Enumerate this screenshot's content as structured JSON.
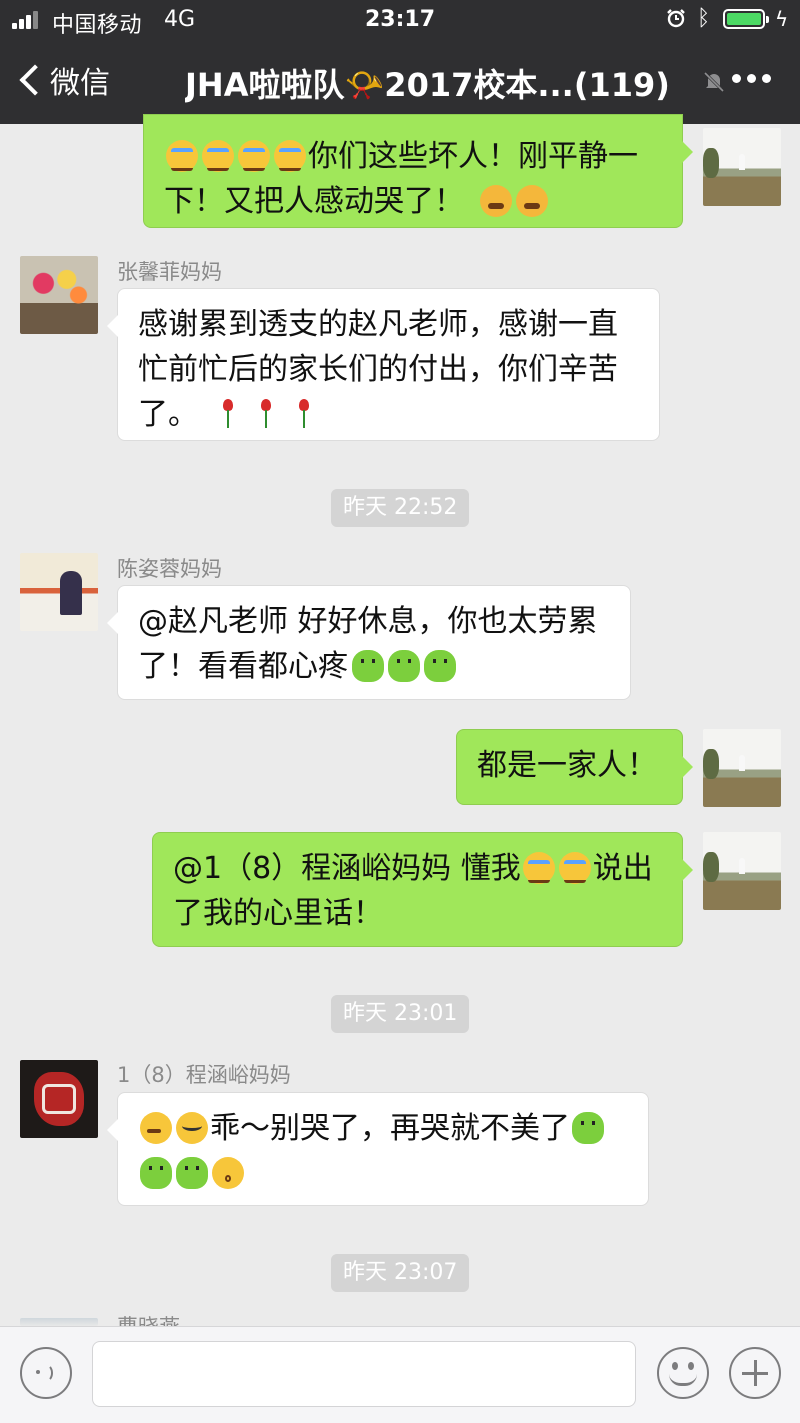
{
  "status_bar": {
    "carrier": "中国移动",
    "network": "4G",
    "time": "23:17",
    "icons": [
      "signal-icon",
      "alarm-icon",
      "bluetooth-icon",
      "battery-icon",
      "charging-icon"
    ],
    "battery_color": "#4cd964"
  },
  "nav": {
    "back_label": "微信",
    "title": "JHA啦啦队📯2017校本...(119)",
    "icons": [
      "back-chevron-icon",
      "mute-icon",
      "more-icon"
    ]
  },
  "messages": [
    {
      "side": "me",
      "text_line1": "你们这些坏人！刚平静一",
      "text_line2": "下！又把人感动哭了！"
    },
    {
      "side": "other",
      "sender": "张馨菲妈妈",
      "text_line1": "感谢累到透支的赵凡老师，感谢一直",
      "text_line2": "忙前忙后的家长们的付出，你们辛苦",
      "text_line3": "了。"
    },
    {
      "side": "other",
      "sender": "陈姿蓉妈妈",
      "text_line1": "@赵凡老师 好好休息，你也太劳累",
      "text_line2": "了！看看都心疼"
    },
    {
      "side": "me",
      "text_line1": "都是一家人！"
    },
    {
      "side": "me",
      "text_line1a": "@1（8）程涵峪妈妈 懂我",
      "text_line1b": "说出",
      "text_line2": "了我的心里话！"
    },
    {
      "side": "other",
      "sender": "1（8）程涵峪妈妈",
      "text_line1": "乖～别哭了，再哭就不美了"
    },
    {
      "side": "other",
      "sender_partial": "曹晓燕"
    }
  ],
  "timestamps": [
    "昨天 22:52",
    "昨天 23:01",
    "昨天 23:07"
  ],
  "input_bar": {
    "icons": [
      "voice-icon",
      "emoji-icon",
      "plus-icon"
    ],
    "placeholder": ""
  },
  "colors": {
    "nav_bg": "#2f2f31",
    "chat_bg": "#ebebeb",
    "my_bubble": "#a0e75a",
    "other_bubble": "#ffffff"
  }
}
